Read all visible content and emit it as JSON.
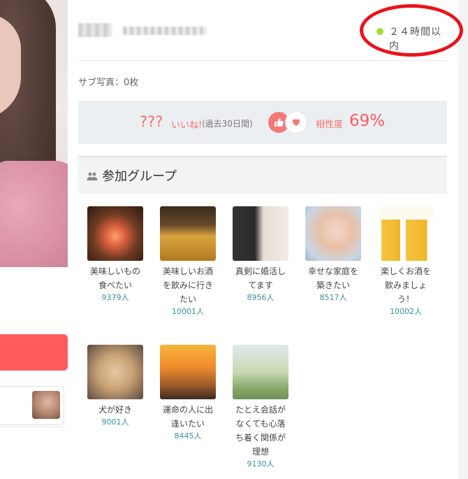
{
  "profile": {
    "online_status": "２４時間以内",
    "sub_photo_text": "サブ写真：0枚"
  },
  "stats": {
    "like_count": "???",
    "like_label": "いいね!",
    "like_period": "(過去30日間)",
    "affinity_label": "相性度",
    "affinity_value": "69%"
  },
  "groups": {
    "title": "参加グループ",
    "items": [
      {
        "name": "美味しいもの食べたい",
        "count": "9379人",
        "thumb": "sushi-photo"
      },
      {
        "name": "美味しいお酒を飲みに行きたい",
        "count": "10001人",
        "thumb": "beer-toast-photo"
      },
      {
        "name": "真剣に婚活してます",
        "count": "8956人",
        "thumb": "couple-photo"
      },
      {
        "name": "幸せな家庭を築きたい",
        "count": "8517人",
        "thumb": "family-photo"
      },
      {
        "name": "楽しくお酒を飲みましょう！",
        "count": "10002人",
        "thumb": "beer-glasses-photo"
      },
      {
        "name": "犬が好き",
        "count": "9001人",
        "thumb": "dog-photo"
      },
      {
        "name": "運命の人に出逢いたい",
        "count": "8445人",
        "thumb": "sunset-hands-photo"
      },
      {
        "name": "たとえ会話がなくても心落ち着く関係が理想",
        "count": "9130人",
        "thumb": "park-couple-photo"
      }
    ]
  },
  "colors": {
    "accent": "#ff5b5f",
    "online_dot": "#a5dc2b",
    "highlight_circle": "#e8141b",
    "count_text": "#3a8fa0"
  }
}
